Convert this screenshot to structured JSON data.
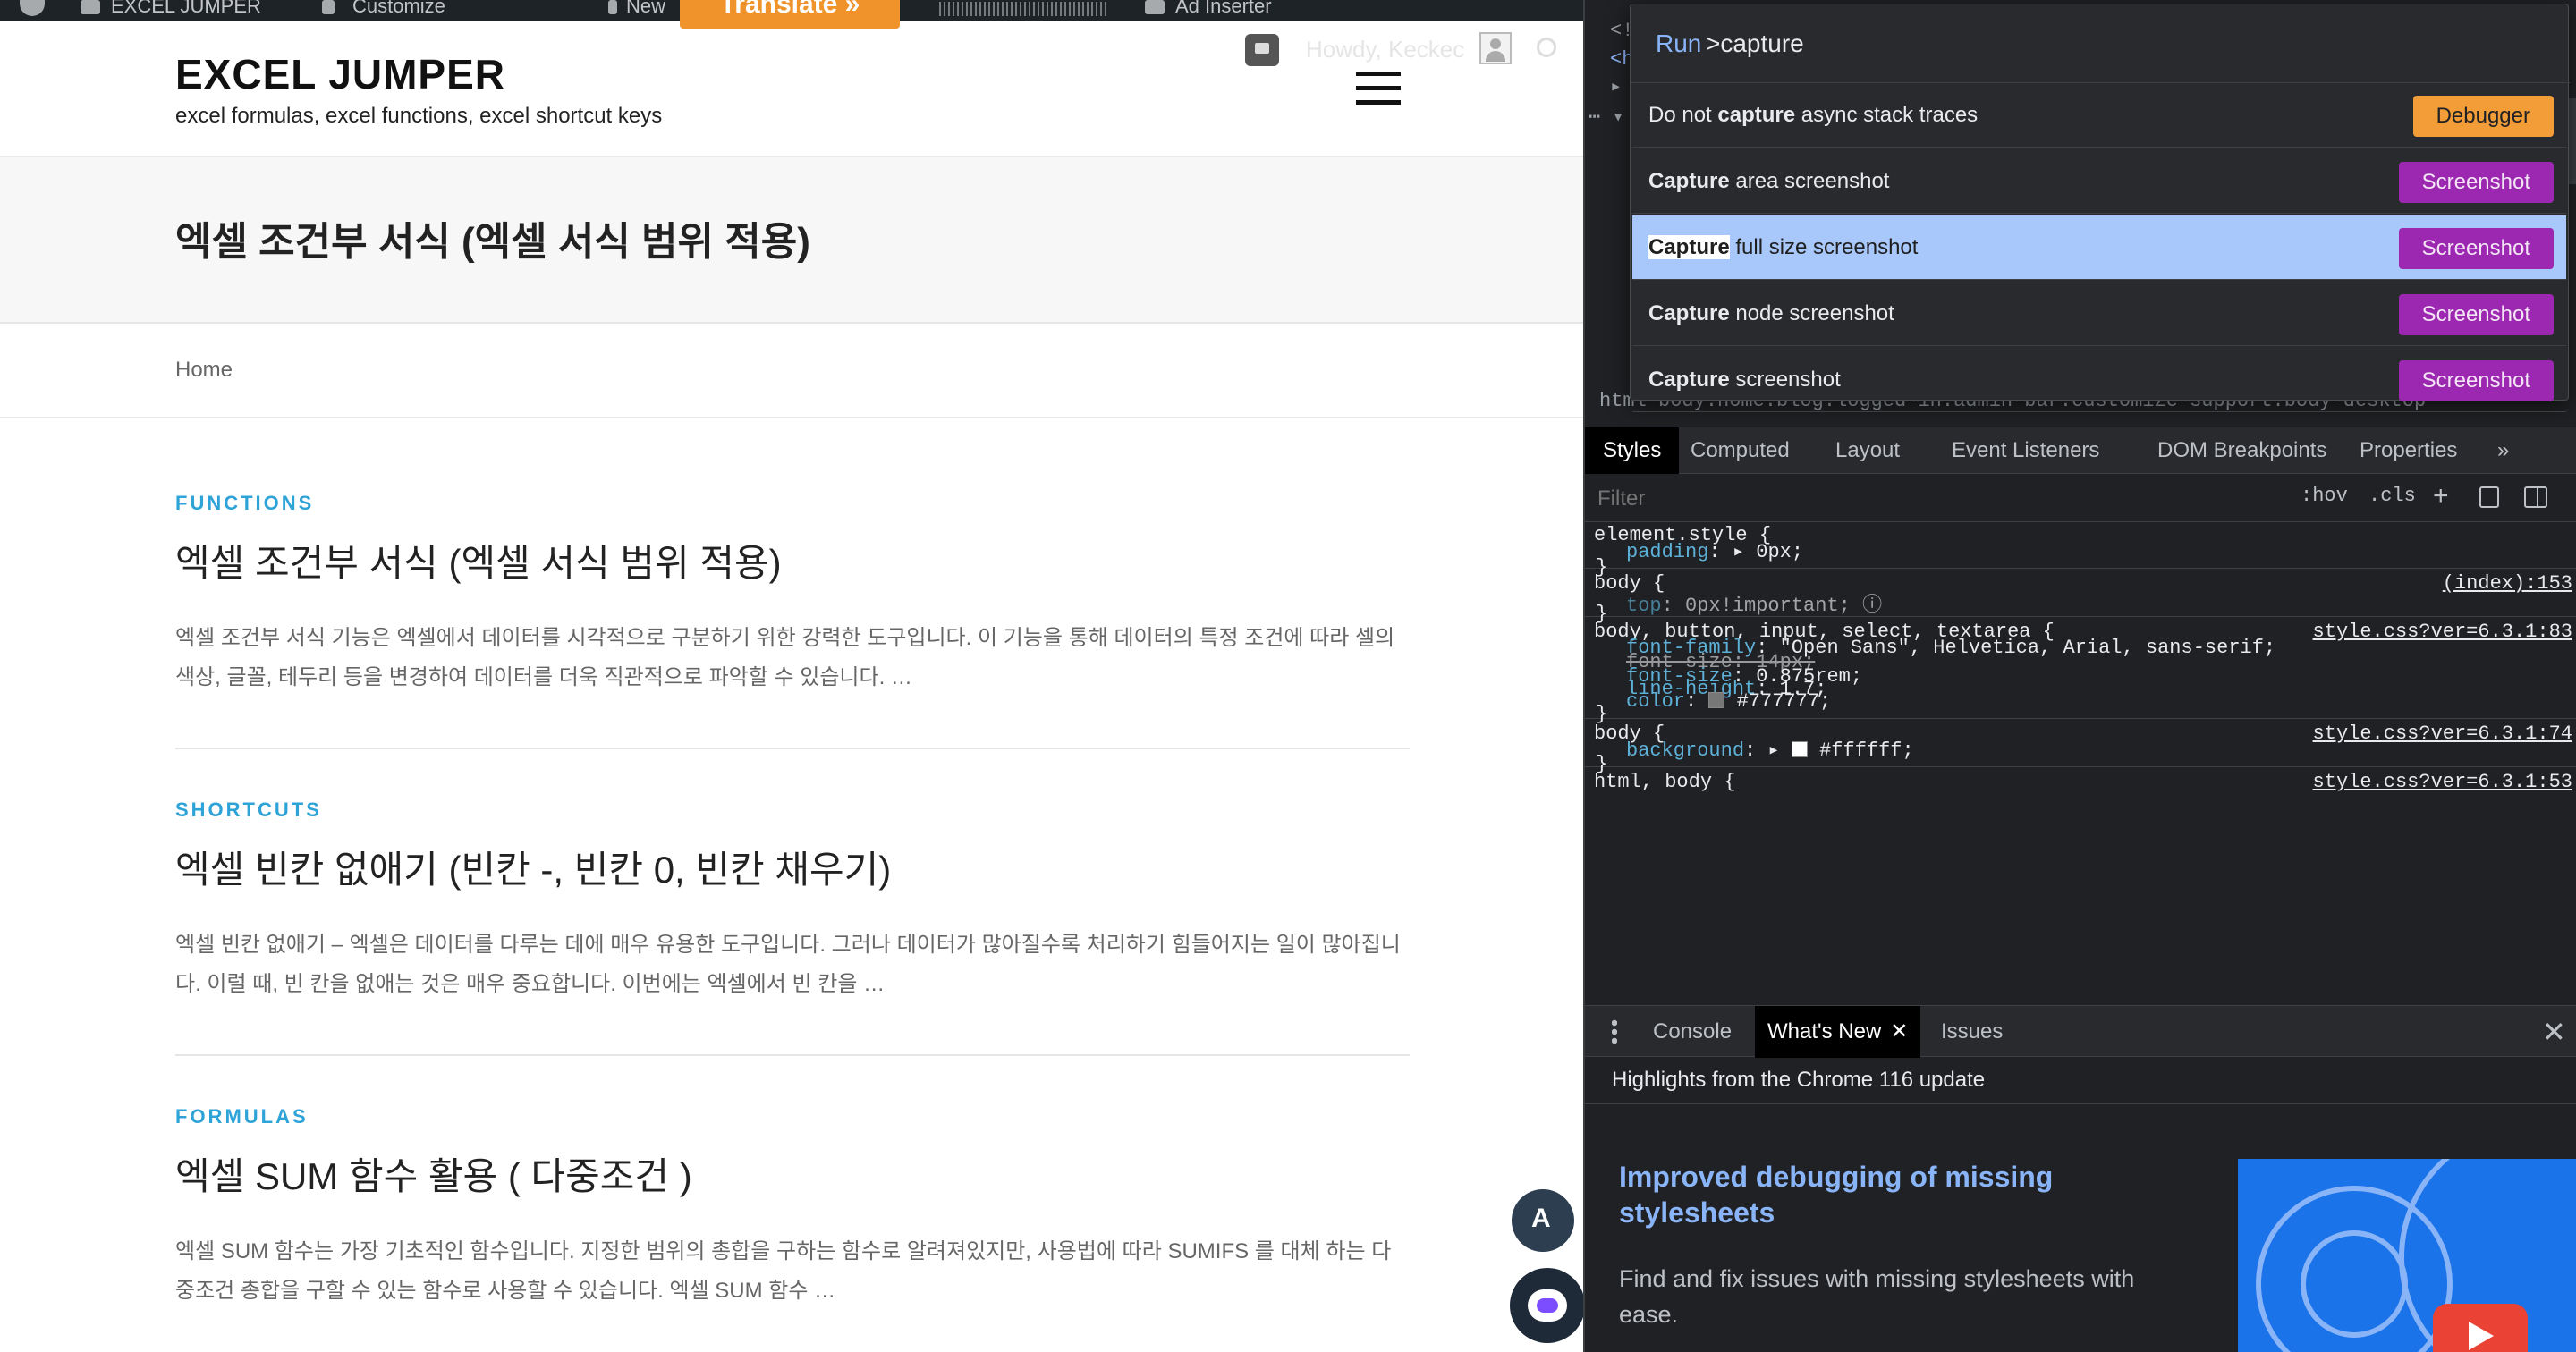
{
  "admin_bar": {
    "site_name": "EXCEL JUMPER",
    "customize": "Customize",
    "new": "New",
    "ad_inserter": "Ad Inserter"
  },
  "translate_button": "Translate »",
  "header": {
    "site_title": "EXCEL JUMPER",
    "tagline": "excel formulas, excel functions, excel shortcut keys",
    "howdy": "Howdy, Keckec"
  },
  "page": {
    "title": "엑셀 조건부 서식 (엑셀 서식 범위 적용)",
    "breadcrumb_home": "Home"
  },
  "posts": [
    {
      "category": "FUNCTIONS",
      "title": "엑셀 조건부 서식 (엑셀 서식 범위 적용)",
      "excerpt": "엑셀 조건부 서식 기능은 엑셀에서 데이터를 시각적으로 구분하기 위한 강력한 도구입니다. 이 기능을 통해 데이터의 특정 조건에 따라 셀의 색상, 글꼴, 테두리 등을 변경하여 데이터를 더욱 직관적으로 파악할 수 있습니다. …"
    },
    {
      "category": "SHORTCUTS",
      "title": "엑셀 빈칸 없애기 (빈칸 -, 빈칸 0, 빈칸 채우기)",
      "excerpt": "엑셀 빈칸 없애기 – 엑셀은 데이터를 다루는 데에 매우 유용한 도구입니다. 그러나 데이터가 많아질수록 처리하기 힘들어지는 일이 많아집니다. 이럴 때, 빈 칸을 없애는 것은 매우 중요합니다. 이번에는 엑셀에서 빈 칸을 …"
    },
    {
      "category": "FORMULAS",
      "title": "엑셀 SUM 함수 활용 ( 다중조건 )",
      "excerpt": "엑셀 SUM 함수는 가장 기초적인 함수입니다. 지정한 범위의 총합을 구하는 함수로 알려져있지만, 사용법에 따라 SUMIFS 를 대체 하는 다중조건 총합을 구할 수 있는 함수로 사용할 수 있습니다. 엑셀 SUM 함수 …"
    }
  ],
  "devtools": {
    "elements_fragments": [
      "<!",
      "<h",
      "▸",
      "⋯ ▾"
    ],
    "right_fragments": [
      "/>",
      "co"
    ],
    "crumb": "html  body.home.blog.logged-in.admin-bar.customize-support.body-desktop",
    "command_menu": {
      "prompt": "Run",
      "query": ">capture",
      "items": [
        {
          "pre": "Do not ",
          "bold": "capture",
          "post": " async stack traces",
          "tag": "Debugger",
          "tag_type": "debugger",
          "selected": false
        },
        {
          "pre": "",
          "bold": "Capture",
          "post": " area screenshot",
          "tag": "Screenshot",
          "tag_type": "screenshot",
          "selected": false
        },
        {
          "pre": "",
          "bold": "Capture",
          "post": " full size screenshot",
          "tag": "Screenshot",
          "tag_type": "screenshot",
          "selected": true
        },
        {
          "pre": "",
          "bold": "Capture",
          "post": " node screenshot",
          "tag": "Screenshot",
          "tag_type": "screenshot",
          "selected": false
        },
        {
          "pre": "",
          "bold": "Capture",
          "post": " screenshot",
          "tag": "Screenshot",
          "tag_type": "screenshot",
          "selected": false
        }
      ]
    },
    "styles_tabs": [
      "Styles",
      "Computed",
      "Layout",
      "Event Listeners",
      "DOM Breakpoints",
      "Properties",
      "»"
    ],
    "active_styles_tab": "Styles",
    "filter_placeholder": "Filter",
    "hov": ":hov",
    "cls": ".cls",
    "plus": "+",
    "rules": {
      "r1_selector": "element.style {",
      "r1_prop": "padding",
      "r1_value": "▸ 0px;",
      "r2_selector": "body {",
      "r2_source": "(index):153",
      "r2_prop": "top",
      "r2_value": "0px!important;",
      "r3_selector": "body, button, input, select, textarea {",
      "r3_source": "style.css?ver=6.3.1:83",
      "r3_p1": "font-family",
      "r3_v1": "\"Open Sans\", Helvetica, Arial, sans-serif;",
      "r3_p2": "font-size: 14px;",
      "r3_p3": "font-size",
      "r3_v3": "0.875rem;",
      "r3_p4": "line-height",
      "r3_v4": "1.7;",
      "r3_p5": "color",
      "r3_v5": "#777777;",
      "r4_selector": "body {",
      "r4_source": "style.css?ver=6.3.1:74",
      "r4_prop": "background",
      "r4_value": "#ffffff;",
      "r5_selector": "html, body {",
      "r5_source": "style.css?ver=6.3.1:53",
      "close_brace": "}"
    },
    "drawer_tabs": [
      "Console",
      "What's New",
      "Issues"
    ],
    "active_drawer_tab": "What's New",
    "highlights": "Highlights from the Chrome 116 update",
    "whats_new": {
      "title": "Improved debugging of missing stylesheets",
      "description": "Find and fix issues with missing stylesheets with ease."
    }
  },
  "colors": {
    "category_blue": "#2ea3d8",
    "devtools_bg": "#202124",
    "debugger_tag": "#f29d37",
    "screenshot_tag": "#9c27b0",
    "selected_row": "#a8c7fa",
    "link_blue": "#8ab4f8",
    "swatch_grey": "#777777",
    "swatch_white": "#ffffff"
  }
}
